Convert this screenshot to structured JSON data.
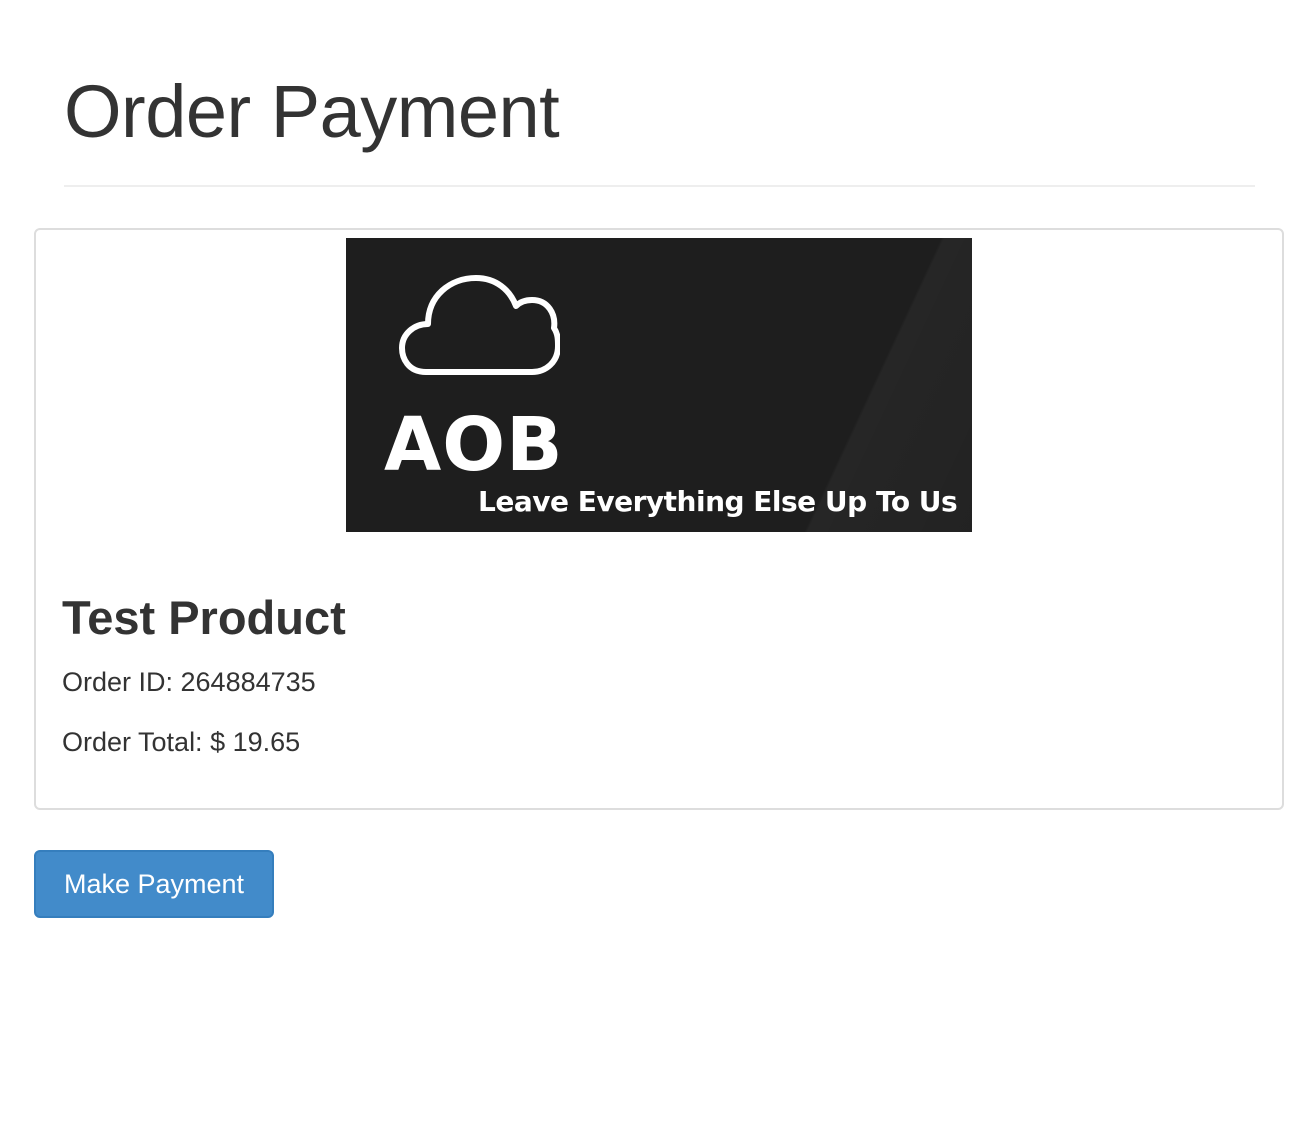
{
  "page": {
    "title": "Order Payment"
  },
  "product": {
    "logo": {
      "icon": "cloud-icon",
      "brand_text": "AOB",
      "tagline": "Leave Everything Else Up To Us",
      "background_color": "#1e1e1e"
    },
    "name": "Test Product",
    "order_id_text": "Order ID: 264884735",
    "order_total_text": "Order Total: $ 19.65"
  },
  "actions": {
    "make_payment_label": "Make Payment",
    "button_color": "#428bca"
  }
}
